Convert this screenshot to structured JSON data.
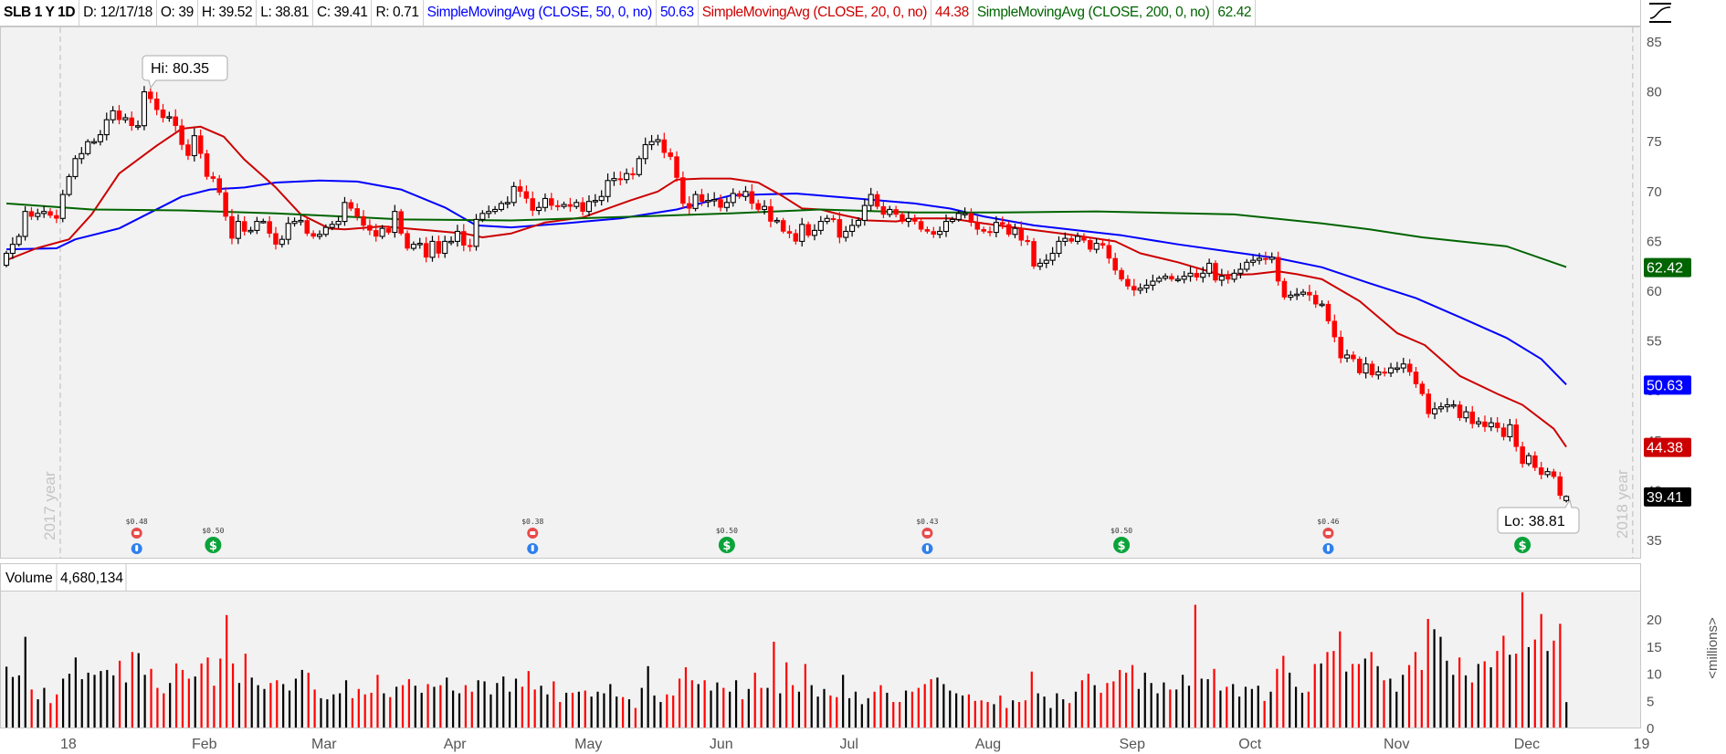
{
  "header": {
    "symbol": "SLB 1 Y 1D",
    "date": "D: 12/17/18",
    "open": "O: 39",
    "high": "H: 39.52",
    "low": "L: 38.81",
    "close": "C: 39.41",
    "range": "R: 0.71",
    "sma50_label": "SimpleMovingAvg (CLOSE, 50, 0, no)",
    "sma50_value": "50.63",
    "sma20_label": "SimpleMovingAvg (CLOSE, 20, 0, no)",
    "sma20_value": "44.38",
    "sma200_label": "SimpleMovingAvg (CLOSE, 200, 0, no)",
    "sma200_value": "62.42",
    "style_icon": "chart-style-icon"
  },
  "volume_panel": {
    "title": "Volume",
    "value": "4,680,134",
    "axis_unit": "<millions>"
  },
  "colors": {
    "up": "#000000",
    "down": "#ff0000",
    "sma50": "#0000ff",
    "sma20": "#cc0000",
    "sma200": "#006400",
    "last": "#000000",
    "plot_bg": "#f2f2f2"
  },
  "chart_data": {
    "type": "candlestick",
    "title": "SLB 1 Y 1D",
    "price_axis": {
      "ylim": [
        33,
        86.5
      ],
      "ticks": [
        85,
        80,
        75,
        70,
        65,
        60,
        55,
        50,
        45,
        40,
        35
      ]
    },
    "volume_axis": {
      "ylim": [
        0,
        25
      ],
      "ticks": [
        20,
        15,
        10,
        5,
        0
      ],
      "unit": "millions"
    },
    "x_ticks": [
      {
        "label": "18",
        "bar": 9.9
      },
      {
        "label": "Feb",
        "bar": 31.6
      },
      {
        "label": "Mar",
        "bar": 50.7
      },
      {
        "label": "Apr",
        "bar": 71.6
      },
      {
        "label": "May",
        "bar": 92.9
      },
      {
        "label": "Jun",
        "bar": 114.1
      },
      {
        "label": "Jul",
        "bar": 134.5
      },
      {
        "label": "Aug",
        "bar": 156.7
      },
      {
        "label": "Sep",
        "bar": 179.7
      },
      {
        "label": "Oct",
        "bar": 198.5
      },
      {
        "label": "Nov",
        "bar": 221.9
      },
      {
        "label": "Dec",
        "bar": 242.7
      },
      {
        "label": "19",
        "bar": 261
      }
    ],
    "year_markers": [
      {
        "label": "2017 year",
        "bar": 8.6
      },
      {
        "label": "2018 year",
        "bar": 259.6
      }
    ],
    "first_open": 62.6,
    "last_bar": {
      "open": 39,
      "high": 39.52,
      "low": 38.81,
      "close": 39.41
    },
    "close": [
      63.8,
      64.7,
      65.5,
      68.0,
      67.5,
      67.8,
      68.0,
      67.6,
      67.3,
      69.7,
      71.5,
      73.3,
      73.8,
      75.0,
      75.0,
      75.7,
      77.2,
      78.1,
      77.2,
      77.4,
      76.6,
      76.6,
      80.0,
      79.3,
      78.2,
      77.4,
      77.5,
      76.6,
      74.7,
      73.6,
      75.6,
      73.8,
      71.5,
      71.3,
      69.9,
      67.5,
      65.3,
      67.0,
      66.0,
      66.1,
      67.0,
      67.0,
      65.8,
      64.7,
      65.2,
      66.8,
      67.0,
      67.1,
      65.8,
      65.5,
      65.7,
      66.4,
      66.7,
      67.0,
      68.9,
      68.3,
      67.5,
      66.6,
      66.1,
      65.5,
      66.3,
      65.9,
      68.0,
      65.8,
      64.3,
      64.7,
      64.8,
      63.4,
      65.0,
      63.8,
      65.0,
      65.0,
      66.0,
      64.6,
      64.5,
      67.2,
      67.8,
      68.0,
      68.2,
      68.8,
      68.9,
      70.5,
      70.0,
      69.3,
      68.1,
      68.4,
      69.3,
      68.6,
      68.5,
      68.7,
      68.5,
      68.9,
      68.0,
      69.0,
      69.1,
      69.5,
      71.1,
      71.3,
      71.2,
      71.8,
      71.7,
      73.3,
      74.7,
      75.0,
      75.2,
      73.9,
      73.5,
      71.4,
      68.8,
      68.3,
      69.7,
      69.0,
      69.1,
      69.2,
      68.4,
      68.9,
      69.8,
      69.5,
      70.0,
      68.8,
      68.2,
      68.5,
      67.0,
      67.1,
      66.0,
      65.8,
      65.0,
      66.7,
      65.6,
      66.1,
      67.0,
      67.3,
      67.2,
      65.4,
      66.0,
      66.6,
      67.1,
      68.6,
      69.7,
      68.5,
      67.7,
      68.2,
      67.7,
      67.0,
      67.3,
      67.0,
      66.2,
      66.0,
      65.7,
      66.0,
      67.0,
      67.2,
      67.8,
      67.8,
      66.9,
      66.2,
      66.0,
      65.9,
      66.9,
      66.7,
      65.7,
      66.3,
      65.1,
      65.0,
      62.5,
      62.8,
      63.1,
      63.8,
      65.0,
      65.3,
      65.0,
      65.5,
      65.1,
      64.2,
      64.8,
      64.6,
      63.3,
      62.1,
      61.2,
      60.5,
      60.1,
      60.3,
      60.6,
      61.0,
      61.3,
      61.5,
      61.2,
      61.2,
      61.5,
      61.8,
      61.4,
      61.8,
      62.8,
      61.1,
      61.5,
      61.2,
      61.8,
      62.2,
      62.9,
      63.1,
      63.3,
      63.2,
      63.4,
      61.0,
      59.4,
      59.6,
      59.7,
      59.9,
      59.6,
      58.7,
      58.7,
      57.0,
      55.4,
      53.3,
      53.6,
      53.2,
      51.8,
      52.7,
      51.6,
      51.9,
      51.8,
      52.3,
      52.3,
      52.7,
      51.9,
      50.7,
      49.7,
      47.7,
      48.2,
      48.4,
      48.6,
      48.6,
      47.3,
      47.9,
      46.7,
      46.9,
      46.4,
      46.8,
      46.3,
      45.4,
      46.6,
      44.4,
      42.7,
      43.5,
      42.3,
      41.6,
      41.9,
      41.4,
      39.5,
      39.41
    ],
    "volume_millions": [
      11.2,
      9.3,
      9.6,
      16.7,
      7.0,
      5.2,
      7.3,
      4.5,
      6.1,
      9.0,
      9.9,
      12.9,
      8.9,
      10.1,
      9.7,
      10.4,
      10.6,
      9.6,
      12.3,
      8.3,
      13.9,
      13.7,
      9.7,
      10.8,
      7.3,
      6.3,
      8.2,
      11.8,
      10.6,
      9.0,
      9.4,
      11.8,
      12.9,
      7.7,
      12.7,
      20.7,
      11.8,
      8.2,
      13.6,
      9.2,
      7.8,
      7.1,
      8.2,
      8.7,
      8.0,
      6.8,
      9.0,
      10.6,
      10.1,
      7.0,
      5.4,
      5.2,
      6.1,
      6.3,
      8.7,
      5.4,
      7.1,
      6.1,
      6.4,
      9.7,
      6.3,
      5.6,
      7.5,
      7.8,
      8.9,
      7.7,
      6.4,
      8.0,
      7.5,
      7.8,
      9.2,
      6.8,
      6.3,
      7.8,
      6.6,
      8.7,
      8.5,
      6.1,
      8.2,
      9.4,
      6.6,
      9.0,
      7.5,
      10.4,
      7.0,
      7.7,
      6.1,
      8.5,
      4.7,
      6.4,
      6.4,
      6.6,
      6.8,
      5.7,
      6.6,
      6.3,
      8.0,
      5.7,
      5.6,
      5.2,
      3.6,
      7.3,
      11.3,
      5.9,
      4.7,
      6.1,
      5.9,
      9.0,
      11.1,
      8.7,
      8.0,
      8.7,
      6.8,
      8.3,
      7.3,
      6.6,
      8.7,
      5.2,
      7.1,
      10.1,
      7.3,
      7.3,
      15.8,
      6.3,
      12.0,
      7.8,
      6.6,
      11.7,
      7.8,
      5.7,
      7.1,
      5.9,
      5.6,
      9.7,
      5.4,
      6.6,
      4.3,
      5.4,
      6.6,
      7.8,
      6.4,
      4.7,
      4.7,
      6.8,
      6.6,
      7.3,
      8.0,
      8.9,
      9.2,
      8.0,
      6.8,
      6.3,
      5.9,
      6.1,
      4.9,
      5.0,
      4.7,
      4.3,
      5.9,
      3.6,
      5.0,
      4.7,
      5.0,
      10.3,
      6.3,
      5.7,
      3.6,
      6.3,
      5.2,
      4.5,
      6.6,
      8.7,
      9.9,
      7.8,
      6.4,
      8.2,
      8.5,
      10.6,
      10.1,
      11.5,
      7.1,
      10.1,
      8.2,
      6.3,
      8.3,
      7.0,
      7.0,
      9.7,
      7.7,
      22.6,
      9.0,
      8.9,
      10.8,
      6.8,
      7.5,
      8.0,
      5.7,
      7.5,
      7.1,
      7.7,
      4.9,
      6.6,
      10.8,
      13.2,
      10.1,
      7.5,
      6.4,
      6.6,
      11.7,
      11.8,
      13.9,
      14.1,
      17.7,
      10.3,
      11.7,
      11.7,
      12.7,
      13.9,
      11.3,
      8.7,
      9.0,
      6.6,
      9.7,
      11.5,
      13.9,
      10.6,
      20.0,
      18.1,
      16.7,
      12.3,
      9.7,
      12.9,
      9.6,
      8.3,
      11.7,
      12.2,
      11.1,
      14.1,
      16.9,
      13.4,
      13.6,
      24.9,
      14.8,
      16.2,
      20.9,
      14.1,
      16.0,
      19.1,
      4.68
    ],
    "series": [
      {
        "name": "SimpleMovingAvg (CLOSE, 50, 0, no)",
        "last": 50.63,
        "points": [
          [
            0,
            64.2
          ],
          [
            8,
            64.3
          ],
          [
            11,
            65.2
          ],
          [
            18,
            66.3
          ],
          [
            28,
            69.5
          ],
          [
            32.5,
            70.2
          ],
          [
            38,
            70.4
          ],
          [
            43,
            70.9
          ],
          [
            50,
            71.1
          ],
          [
            56,
            71.0
          ],
          [
            63,
            70.2
          ],
          [
            70,
            68.4
          ],
          [
            75,
            66.6
          ],
          [
            80.6,
            66.4
          ],
          [
            89,
            66.8
          ],
          [
            98,
            67.3
          ],
          [
            107,
            68.2
          ],
          [
            115.6,
            69.6
          ],
          [
            120,
            69.7
          ],
          [
            126,
            69.8
          ],
          [
            130,
            69.6
          ],
          [
            137.5,
            69.2
          ],
          [
            145,
            68.8
          ],
          [
            150.6,
            68.3
          ],
          [
            156,
            67.5
          ],
          [
            164,
            66.6
          ],
          [
            171,
            66.1
          ],
          [
            178,
            65.6
          ],
          [
            187,
            64.7
          ],
          [
            196,
            63.9
          ],
          [
            203,
            63.3
          ],
          [
            210,
            62.4
          ],
          [
            217.6,
            60.8
          ],
          [
            225,
            59.3
          ],
          [
            232,
            57.4
          ],
          [
            239.5,
            55.3
          ],
          [
            245,
            53.2
          ],
          [
            249,
            50.63
          ]
        ]
      },
      {
        "name": "SimpleMovingAvg (CLOSE, 20, 0, no)",
        "last": 44.38,
        "points": [
          [
            0,
            63.1
          ],
          [
            4.8,
            64.3
          ],
          [
            10,
            65.2
          ],
          [
            13.6,
            67.7
          ],
          [
            18,
            71.8
          ],
          [
            24,
            74.6
          ],
          [
            28,
            76.3
          ],
          [
            31,
            76.5
          ],
          [
            34.7,
            75.5
          ],
          [
            38,
            73.2
          ],
          [
            43,
            70.4
          ],
          [
            47,
            67.7
          ],
          [
            51.5,
            66.3
          ],
          [
            54,
            66.2
          ],
          [
            60,
            66.5
          ],
          [
            67.5,
            66.1
          ],
          [
            73,
            65.8
          ],
          [
            76,
            65.4
          ],
          [
            80.6,
            65.8
          ],
          [
            86,
            66.9
          ],
          [
            92,
            67.4
          ],
          [
            99.6,
            69.1
          ],
          [
            104,
            70.0
          ],
          [
            107,
            71.2
          ],
          [
            111,
            71.3
          ],
          [
            115.6,
            71.3
          ],
          [
            120,
            70.9
          ],
          [
            124,
            69.5
          ],
          [
            127,
            68.3
          ],
          [
            130,
            68.2
          ],
          [
            133,
            67.7
          ],
          [
            137.5,
            67.1
          ],
          [
            142,
            67.0
          ],
          [
            145,
            67.3
          ],
          [
            150.6,
            67.3
          ],
          [
            156,
            66.8
          ],
          [
            162,
            66.3
          ],
          [
            169.5,
            65.7
          ],
          [
            177,
            65.0
          ],
          [
            181,
            63.8
          ],
          [
            187,
            62.9
          ],
          [
            194,
            61.6
          ],
          [
            199,
            61.7
          ],
          [
            203,
            62.0
          ],
          [
            206,
            61.7
          ],
          [
            210,
            61.2
          ],
          [
            216,
            59.0
          ],
          [
            222,
            55.8
          ],
          [
            226.4,
            54.6
          ],
          [
            232,
            51.5
          ],
          [
            238,
            49.7
          ],
          [
            242,
            48.6
          ],
          [
            247,
            46.2
          ],
          [
            249,
            44.38
          ]
        ]
      },
      {
        "name": "SimpleMovingAvg (CLOSE, 200, 0, no)",
        "last": 62.42,
        "points": [
          [
            0,
            68.8
          ],
          [
            13.6,
            68.2
          ],
          [
            28,
            68.1
          ],
          [
            43,
            67.8
          ],
          [
            57,
            67.4
          ],
          [
            63,
            67.2
          ],
          [
            80.6,
            67.1
          ],
          [
            101,
            67.5
          ],
          [
            115.6,
            67.8
          ],
          [
            130,
            68.2
          ],
          [
            145,
            67.9
          ],
          [
            159,
            67.9
          ],
          [
            174,
            68.0
          ],
          [
            188.5,
            67.8
          ],
          [
            196,
            67.7
          ],
          [
            210,
            66.8
          ],
          [
            217.6,
            66.2
          ],
          [
            226,
            65.4
          ],
          [
            239.5,
            64.5
          ],
          [
            249,
            62.42
          ]
        ]
      }
    ],
    "annotations": {
      "hi": {
        "label": "Hi: 80.35",
        "value": 80.35,
        "bar": 23
      },
      "lo": {
        "label": "Lo: 38.81",
        "value": 38.81,
        "bar": 249
      }
    },
    "events": [
      {
        "type": "earnings",
        "bar": 20.8,
        "label": "$0.48"
      },
      {
        "type": "dividend",
        "bar": 33,
        "label": "$0.50"
      },
      {
        "type": "earnings",
        "bar": 84,
        "label": "$0.38"
      },
      {
        "type": "dividend",
        "bar": 115,
        "label": "$0.50"
      },
      {
        "type": "earnings",
        "bar": 147,
        "label": "$0.43"
      },
      {
        "type": "dividend",
        "bar": 178,
        "label": "$0.50"
      },
      {
        "type": "earnings",
        "bar": 211,
        "label": "$0.46"
      },
      {
        "type": "dividend",
        "bar": 242,
        "label": ""
      }
    ]
  }
}
